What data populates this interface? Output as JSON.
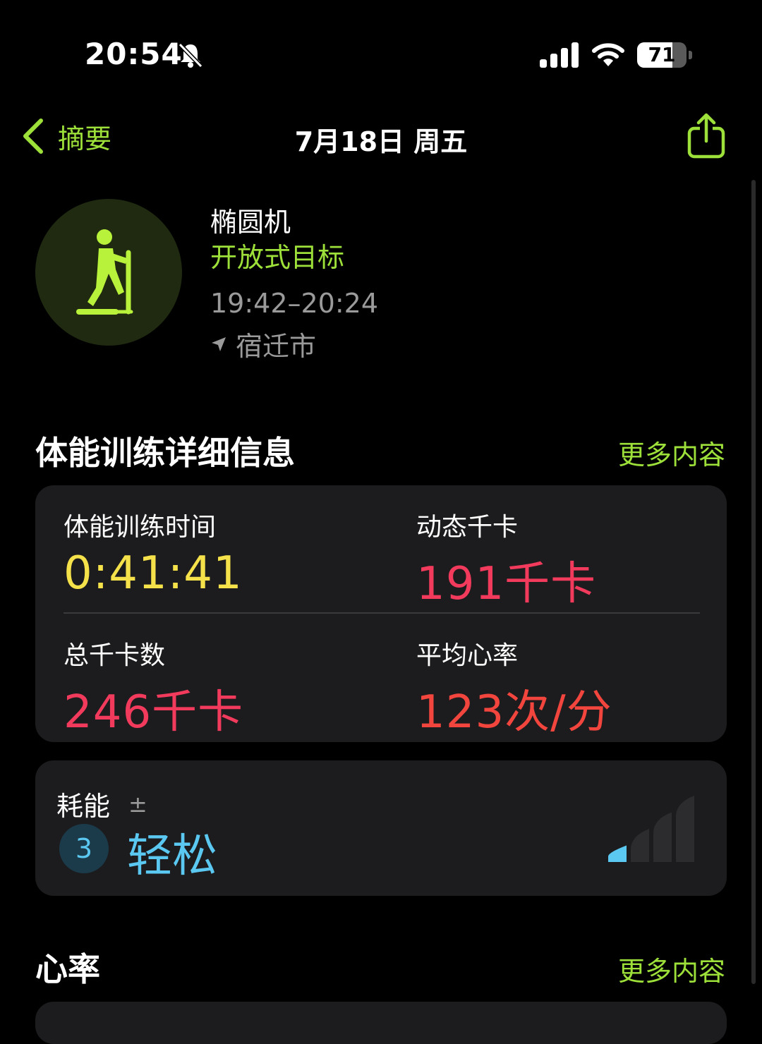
{
  "status_bar": {
    "time": "20:54",
    "battery": "71",
    "battery_level_percent": 71
  },
  "nav": {
    "back_label": "摘要",
    "title": "7月18日 周五"
  },
  "workout": {
    "name": "椭圆机",
    "goal": "开放式目标",
    "time_range": "19:42–20:24",
    "location": "宿迁市"
  },
  "details": {
    "section_title": "体能训练详细信息",
    "more_label": "更多内容",
    "metrics": [
      {
        "label": "体能训练时间",
        "value": "0:41:41",
        "color": "#f5e14a"
      },
      {
        "label": "动态千卡",
        "value": "191千卡",
        "color": "#f23b5c"
      },
      {
        "label": "总千卡数",
        "value": "246千卡",
        "color": "#f23b5c"
      },
      {
        "label": "平均心率",
        "value": "123次/分",
        "color": "#f2453d"
      }
    ]
  },
  "effort": {
    "label": "耗能",
    "info_symbol": "±",
    "level": "3",
    "level_text": "轻松",
    "level_of_max": 1,
    "max_level": 4
  },
  "heart_rate": {
    "section_title": "心率",
    "more_label": "更多内容"
  },
  "colors": {
    "accent_green": "#9ee03a",
    "effort_blue": "#5ac8f0",
    "card_bg": "#1c1c1e"
  },
  "icons": [
    "bell-slash-icon",
    "cellular-signal-icon",
    "wifi-icon",
    "battery-icon",
    "chevron-left-icon",
    "share-icon",
    "elliptical-icon",
    "location-arrow-icon",
    "effort-bars-icon"
  ]
}
